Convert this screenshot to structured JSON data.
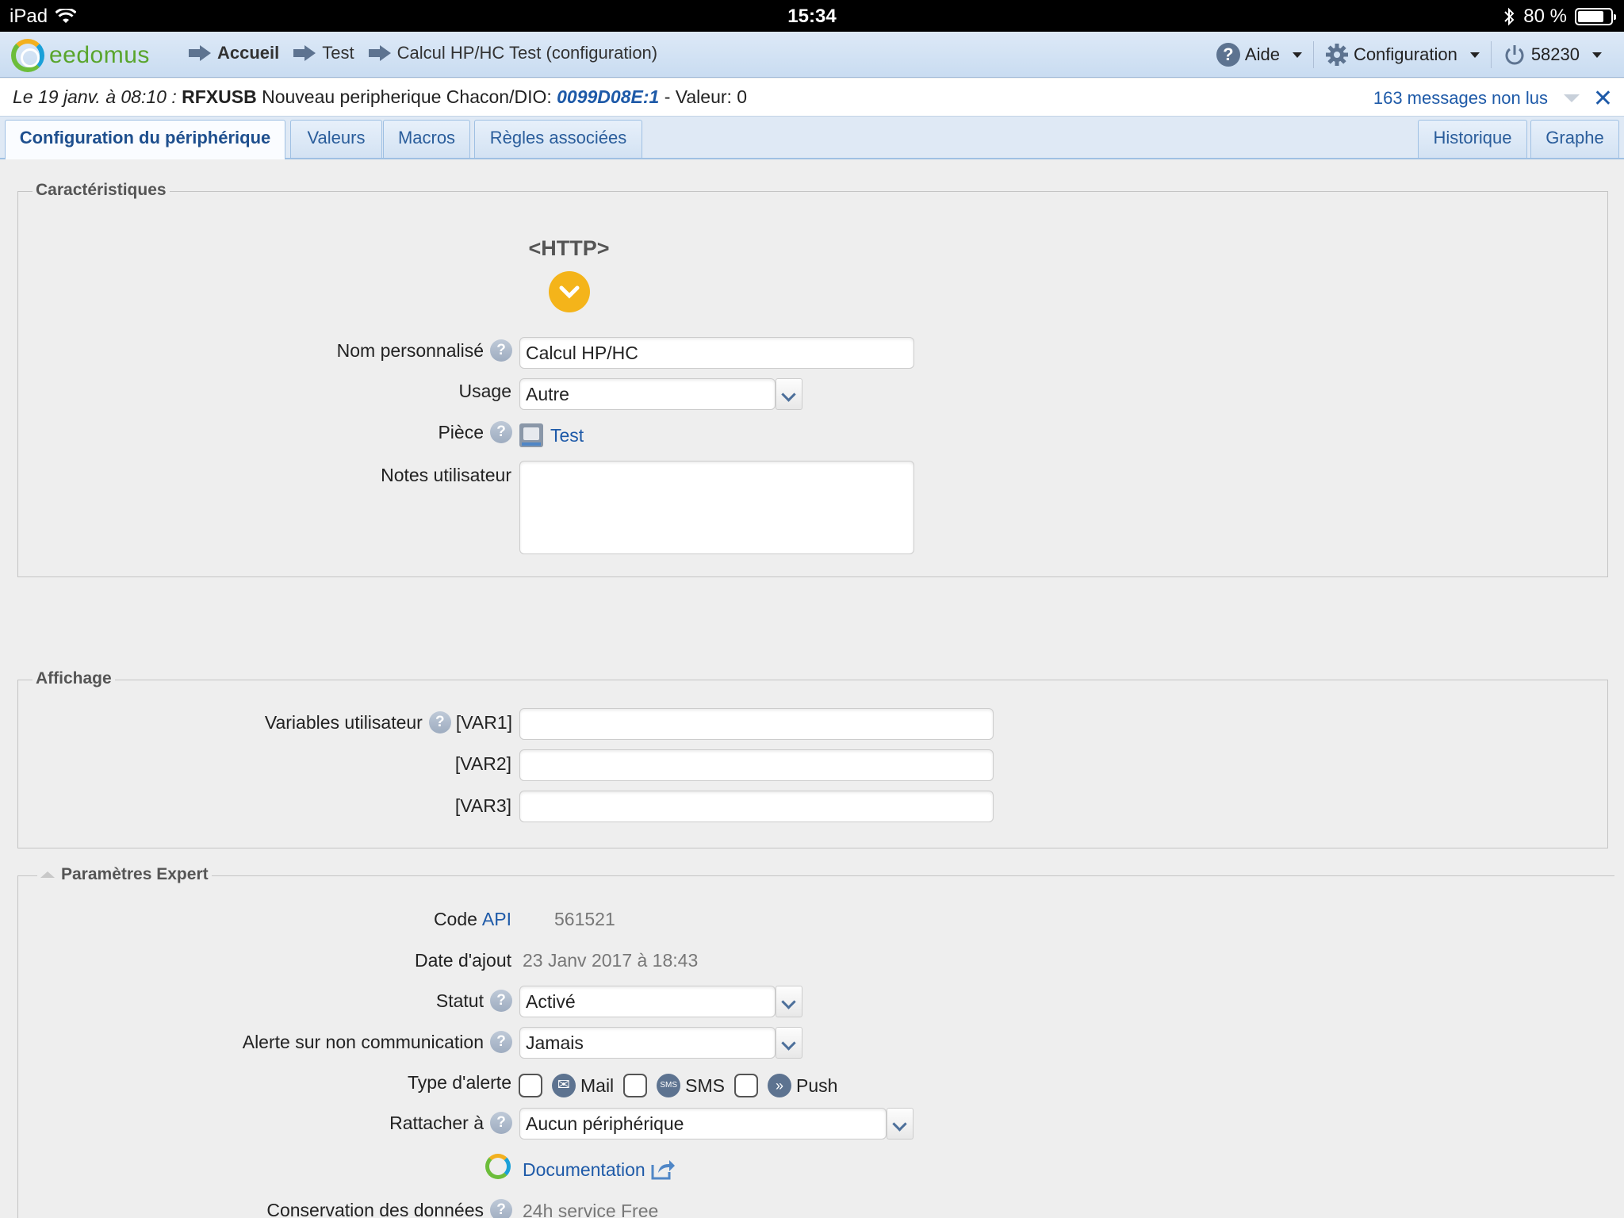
{
  "status_bar": {
    "device": "iPad",
    "time": "15:34",
    "battery": "80 %",
    "battery_level": 0.8
  },
  "nav": {
    "logo_text": "eedomus",
    "breadcrumbs": [
      "Accueil",
      "Test",
      "Calcul HP/HC Test (configuration)"
    ],
    "help_label": "Aide",
    "config_label": "Configuration",
    "user_id": "58230"
  },
  "notification": {
    "date": "Le 19 janv. à 08:10 :",
    "source": "RFXUSB",
    "text": "Nouveau peripherique Chacon/DIO:",
    "device_id": "0099D08E:1",
    "value_text": "- Valeur: 0",
    "unread": "163 messages non lus",
    "close": "✕"
  },
  "tabs": {
    "left": [
      "Configuration du périphérique",
      "Valeurs",
      "Macros",
      "Règles associées"
    ],
    "right": [
      "Historique",
      "Graphe"
    ],
    "active": "Configuration du périphérique"
  },
  "caracteristiques": {
    "legend": "Caractéristiques",
    "device_type": "<HTTP>",
    "name_label": "Nom personnalisé",
    "name_value": "Calcul HP/HC",
    "usage_label": "Usage",
    "usage_value": "Autre",
    "room_label": "Pièce",
    "room_value": "Test",
    "notes_label": "Notes utilisateur",
    "notes_value": ""
  },
  "affichage": {
    "legend": "Affichage",
    "vars_label": "Variables utilisateur",
    "var1_label": "[VAR1]",
    "var2_label": "[VAR2]",
    "var3_label": "[VAR3]"
  },
  "expert": {
    "legend": "Paramètres Expert",
    "code_label": "Code",
    "code_link": "API",
    "code_value": "561521",
    "date_label": "Date d'ajout",
    "date_value": "23 Janv 2017 à 18:43",
    "status_label": "Statut",
    "status_value": "Activé",
    "alert_label": "Alerte sur non communication",
    "alert_value": "Jamais",
    "alert_type_label": "Type d'alerte",
    "mail_label": "Mail",
    "sms_icon": "SMS",
    "sms_label": "SMS",
    "push_label": "Push",
    "attach_label": "Rattacher à",
    "attach_value": "Aucun périphérique",
    "doc_label": "Documentation",
    "retention_label": "Conservation des données",
    "retention_value": "24h service Free"
  },
  "colors": {
    "accent": "#1e5aa8",
    "nav_bg": "#c9dcf1",
    "logo_green": "#59a52c",
    "http_badge": "#f4b41a"
  }
}
